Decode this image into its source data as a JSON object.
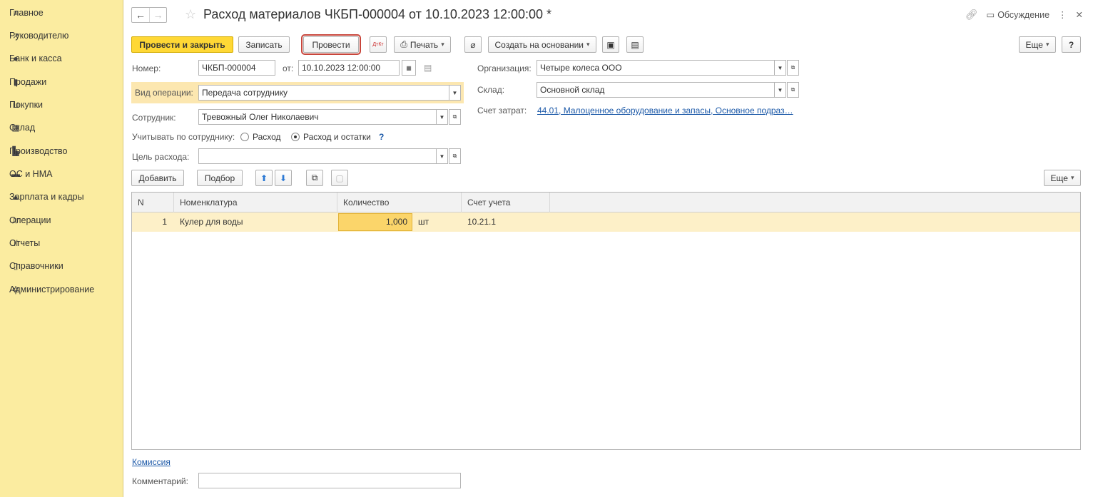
{
  "sidebar": {
    "items": [
      {
        "label": "Главное",
        "icon": "menu-icon"
      },
      {
        "label": "Руководителю",
        "icon": "chart-trend-icon"
      },
      {
        "label": "Банк и касса",
        "icon": "coin-icon"
      },
      {
        "label": "Продажи",
        "icon": "shopping-bag-icon"
      },
      {
        "label": "Покупки",
        "icon": "cart-icon"
      },
      {
        "label": "Склад",
        "icon": "warehouse-icon"
      },
      {
        "label": "Производство",
        "icon": "factory-icon"
      },
      {
        "label": "ОС и НМА",
        "icon": "truck-icon"
      },
      {
        "label": "Зарплата и кадры",
        "icon": "person-icon"
      },
      {
        "label": "Операции",
        "icon": "dt-kt-icon"
      },
      {
        "label": "Отчеты",
        "icon": "bar-chart-icon"
      },
      {
        "label": "Справочники",
        "icon": "book-icon"
      },
      {
        "label": "Администрирование",
        "icon": "gear-icon"
      }
    ]
  },
  "header": {
    "title": "Расход материалов ЧКБП-000004 от 10.10.2023 12:00:00 *",
    "discussion_label": "Обсуждение"
  },
  "toolbar": {
    "post_close": "Провести и закрыть",
    "save": "Записать",
    "post": "Провести",
    "print": "Печать",
    "create_based": "Создать на основании",
    "more": "Еще",
    "help": "?"
  },
  "form": {
    "number_label": "Номер:",
    "number_value": "ЧКБП-000004",
    "from_label": "от:",
    "date_value": "10.10.2023 12:00:00",
    "org_label": "Организация:",
    "org_value": "Четыре колеса ООО",
    "optype_label": "Вид операции:",
    "optype_value": "Передача сотруднику",
    "warehouse_label": "Склад:",
    "warehouse_value": "Основной склад",
    "employee_label": "Сотрудник:",
    "employee_value": "Тревожный Олег Николаевич",
    "cost_account_label": "Счет затрат:",
    "cost_account_value": "44.01, Малоценное оборудование и запасы, Основное подраз…",
    "account_by_label": "Учитывать по сотруднику:",
    "radio_1": "Расход",
    "radio_2": "Расход и остатки",
    "help_mark": "?",
    "purpose_label": "Цель расхода:",
    "purpose_value": ""
  },
  "table_toolbar": {
    "add": "Добавить",
    "pick": "Подбор",
    "more": "Еще"
  },
  "table": {
    "headers": [
      "N",
      "Номенклатура",
      "Количество",
      "Счет учета"
    ],
    "rows": [
      {
        "n": "1",
        "item": "Кулер для воды",
        "qty": "1,000",
        "unit": "шт",
        "account": "10.21.1"
      }
    ]
  },
  "footer": {
    "commission_link": "Комиссия",
    "comment_label": "Комментарий:",
    "comment_value": ""
  }
}
